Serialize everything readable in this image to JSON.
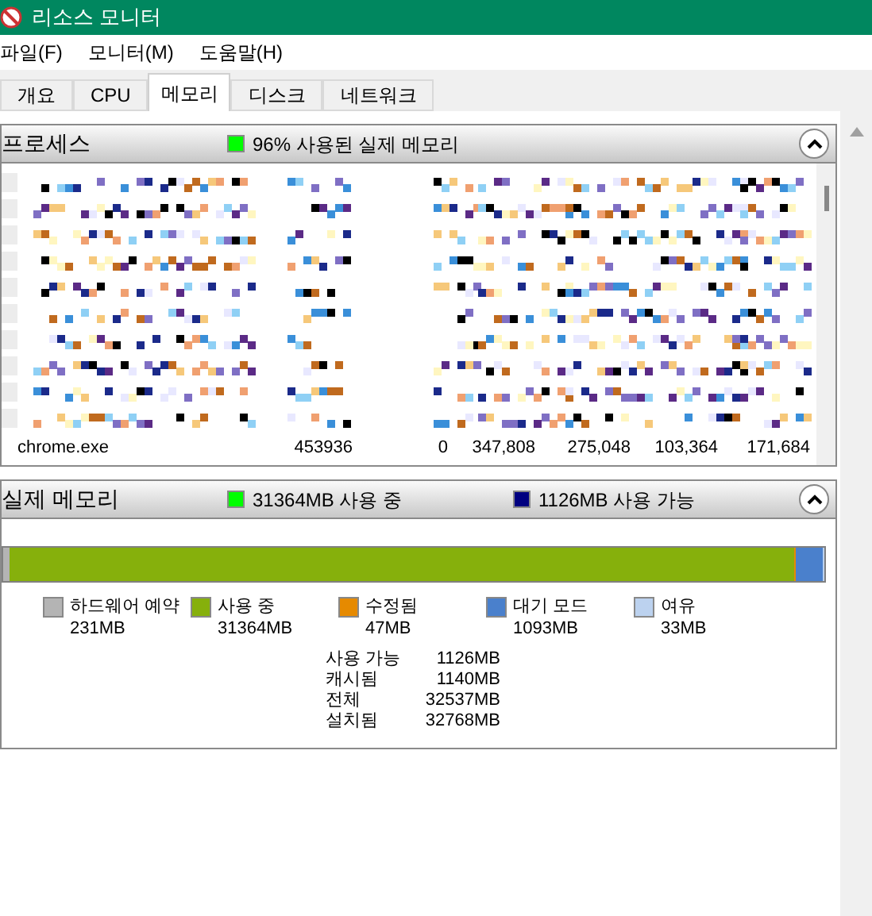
{
  "window": {
    "title": "리소스 모니터"
  },
  "menu": [
    "파일(F)",
    "모니터(M)",
    "도움말(H)"
  ],
  "tabs": [
    {
      "label": "개요",
      "selected": false
    },
    {
      "label": "CPU",
      "selected": false
    },
    {
      "label": "메모리",
      "selected": true
    },
    {
      "label": "디스크",
      "selected": false
    },
    {
      "label": "네트워크",
      "selected": false
    }
  ],
  "processes": {
    "title": "프로세스",
    "legend": [
      {
        "text": "96% 사용된 실제 메모리",
        "color": "#00ff00"
      }
    ],
    "expanded": true,
    "last_row": [
      "chrome.exe",
      "453936",
      "0",
      "347,808",
      "275,048",
      "103,364",
      "171,684"
    ]
  },
  "physical_memory": {
    "title": "실제 메모리",
    "expanded": true,
    "legend": [
      {
        "text": "31364MB 사용 중",
        "color": "#00ff00"
      },
      {
        "text": "1126MB 사용 가능",
        "color": "#000080"
      }
    ],
    "bar": [
      {
        "name": "하드웨어 예약",
        "value": "231MB",
        "color": "#b4b4b4",
        "level": 0.007
      },
      {
        "name": "사용 중",
        "value": "31364MB",
        "color": "#86b00c",
        "level": 0.957
      },
      {
        "name": "수정됨",
        "value": "47MB",
        "color": "#e68a00",
        "level": 0.0014
      },
      {
        "name": "대기 모드",
        "value": "1093MB",
        "color": "#4a80cc",
        "level": 0.033
      },
      {
        "name": "여유",
        "value": "33MB",
        "color": "#bcd2ef",
        "level": 0.001
      }
    ],
    "stats": [
      {
        "label": "사용 가능",
        "value": "1126MB"
      },
      {
        "label": "캐시됨",
        "value": "1140MB"
      },
      {
        "label": "전체",
        "value": "32537MB"
      },
      {
        "label": "설치됨",
        "value": "32768MB"
      }
    ]
  }
}
